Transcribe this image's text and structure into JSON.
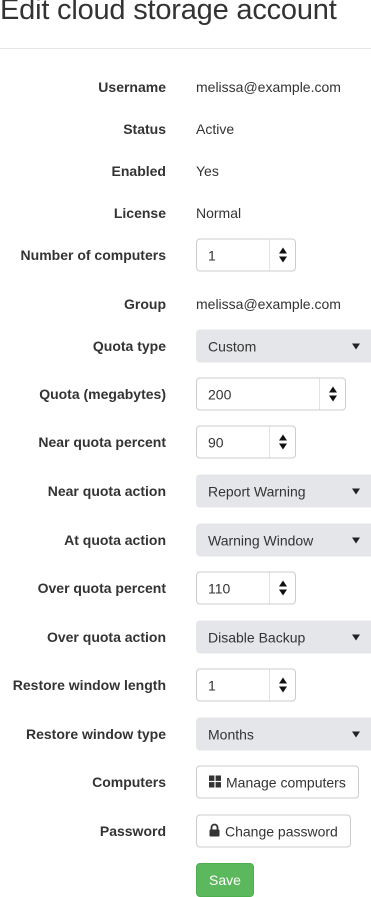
{
  "page": {
    "title": "Edit cloud storage account"
  },
  "fields": {
    "username": {
      "label": "Username",
      "value": "melissa@example.com"
    },
    "status": {
      "label": "Status",
      "value": "Active"
    },
    "enabled": {
      "label": "Enabled",
      "value": "Yes"
    },
    "license": {
      "label": "License",
      "value": "Normal"
    },
    "number_of_computers": {
      "label": "Number of computers",
      "value": "1"
    },
    "group": {
      "label": "Group",
      "value": "melissa@example.com"
    },
    "quota_type": {
      "label": "Quota type",
      "value": "Custom"
    },
    "quota_megabytes": {
      "label": "Quota (megabytes)",
      "value": "200"
    },
    "near_quota_percent": {
      "label": "Near quota percent",
      "value": "90"
    },
    "near_quota_action": {
      "label": "Near quota action",
      "value": "Report Warning"
    },
    "at_quota_action": {
      "label": "At quota action",
      "value": "Warning Window"
    },
    "over_quota_percent": {
      "label": "Over quota percent",
      "value": "110"
    },
    "over_quota_action": {
      "label": "Over quota action",
      "value": "Disable Backup"
    },
    "restore_window_length": {
      "label": "Restore window length",
      "value": "1"
    },
    "restore_window_type": {
      "label": "Restore window type",
      "value": "Months"
    },
    "computers": {
      "label": "Computers",
      "button": "Manage computers",
      "icon": "windows-icon"
    },
    "password": {
      "label": "Password",
      "button": "Change password",
      "icon": "lock-icon"
    }
  },
  "actions": {
    "save": "Save"
  },
  "colors": {
    "save_button": "#5cb85c",
    "select_background": "#e4e6ea"
  }
}
